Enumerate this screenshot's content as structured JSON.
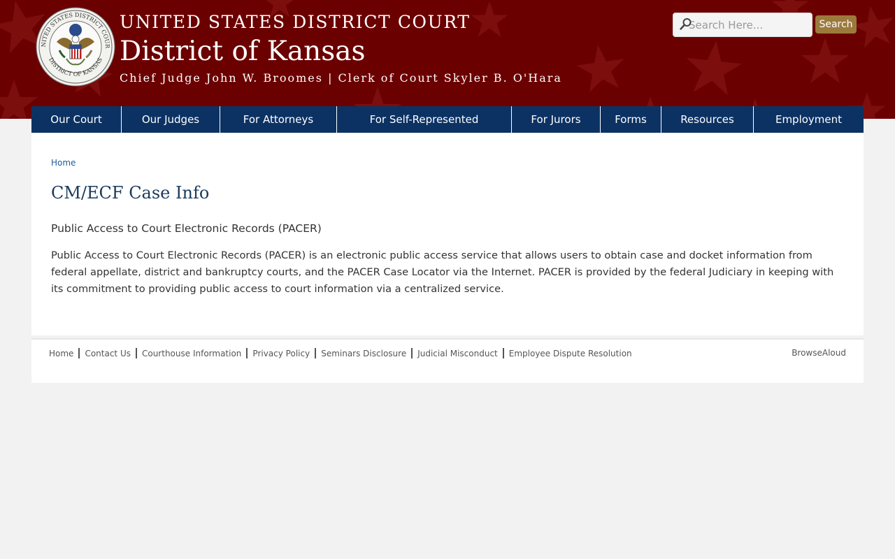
{
  "header": {
    "court_name": "UNITED STATES DISTRICT COURT",
    "district_name": "District of Kansas",
    "judges_line": "Chief Judge John W. Broomes | Clerk of Court Skyler B. O'Hara",
    "seal": {
      "top_text": "UNITED STATES DISTRICT COURT",
      "bottom_text": "DISTRICT OF KANSAS",
      "icon": "eagle-seal"
    },
    "search": {
      "placeholder": "Search Here...",
      "button_label": "Search"
    }
  },
  "nav": {
    "items": [
      {
        "label": "Our Court"
      },
      {
        "label": "Our Judges"
      },
      {
        "label": "For Attorneys"
      },
      {
        "label": "For Self-Represented"
      },
      {
        "label": "For Jurors"
      },
      {
        "label": "Forms"
      },
      {
        "label": "Resources"
      },
      {
        "label": "Employment"
      }
    ]
  },
  "main": {
    "breadcrumb": "Home",
    "title": "CM/ECF Case Info",
    "subheading": "Public Access to Court Electronic Records (PACER)",
    "body": "Public Access to Court Electronic Records (PACER) is an electronic public access service that allows users to obtain case and docket information from federal appellate, district and bankruptcy courts, and the PACER Case Locator via the Internet. PACER is provided by the federal Judiciary in keeping with its commitment to providing public access to court information via a centralized service."
  },
  "footer": {
    "links": [
      {
        "label": "Home"
      },
      {
        "label": "Contact Us"
      },
      {
        "label": "Courthouse Information"
      },
      {
        "label": "Privacy Policy"
      },
      {
        "label": "Seminars Disclosure"
      },
      {
        "label": "Judicial Misconduct"
      },
      {
        "label": "Employee Dispute Resolution"
      }
    ],
    "browsealoud": "BrowseAloud"
  },
  "colors": {
    "header_bg": "#6b0000",
    "nav_bg": "#0c3263",
    "search_button": "#9c7a3c",
    "title": "#1b3a5c",
    "link": "#1f5c99"
  }
}
